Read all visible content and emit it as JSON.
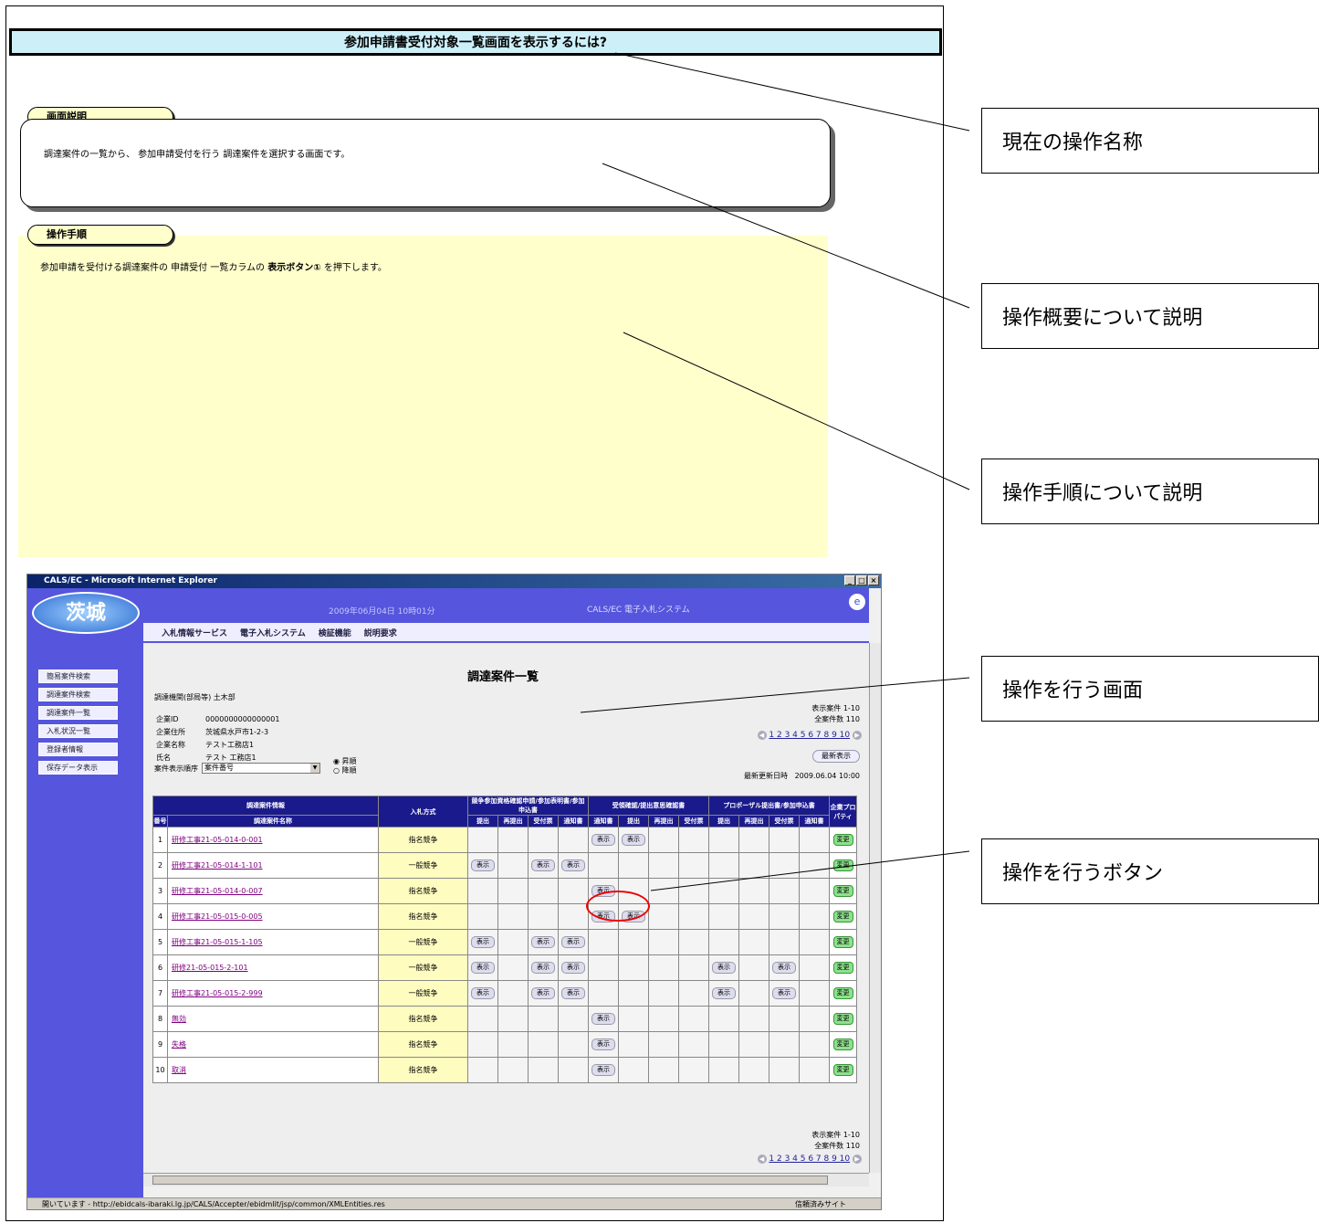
{
  "manual": {
    "title": "参加申請書受付対象一覧画面を表示するには?",
    "section1_label": "画面説明",
    "section1_text": "調達案件の一覧から、 参加申請受付を行う 調達案件を選択する画面です。",
    "section2_label": "操作手順",
    "section2_text_pre": "参加申請を受付ける調達案件の 申請受付 一覧カラムの ",
    "section2_text_bold": "表示ボタン①",
    "section2_text_post": " を押下します。"
  },
  "callouts": [
    "現在の操作名称",
    "操作概要について説明",
    "操作手順について説明",
    "操作を行う画面",
    "操作を行うボタン"
  ],
  "ie": {
    "window_title": "CALS/EC - Microsoft Internet Explorer",
    "logo_text": "茨城",
    "datetime": "2009年06月04日 10時01分",
    "system_name": "CALS/EC 電子入札システム",
    "menu": [
      "入札情報サービス",
      "電子入札システム",
      "検証機能",
      "説明要求"
    ],
    "sidebar": [
      "簡易案件検索",
      "調達案件検索",
      "調達案件一覧",
      "入札状況一覧",
      "登録者情報",
      "保存データ表示"
    ],
    "page_title": "調達案件一覧",
    "org_label": "調達機関(部局等)",
    "org_value": "土木部",
    "company_id_label": "企業ID",
    "company_id": "0000000000000001",
    "address_label": "企業住所",
    "address": "茨城県水戸市1-2-3",
    "company_name_label": "企業名称",
    "company_name": "テスト工務店1",
    "person_label": "氏名",
    "person": "テスト 工務店1",
    "display_range": "表示案件 1-10",
    "total": "全案件数 110",
    "pages": "1 2 3 4 5 6 7 8 9 10",
    "latest_button": "最新表示",
    "sort_label": "案件表示順序",
    "sort_value": "案件番号",
    "radio_asc": "昇順",
    "radio_desc": "降順",
    "updated_label": "最新更新日時",
    "updated_value": "2009.06.04 10:00",
    "table_headers": {
      "case_info": "調達案件情報",
      "method": "入札方式",
      "group1": "競争参加資格確認申請/参加表明書/参加申込書",
      "group2": "受領確認/提出意思確認書",
      "group3": "プロポーザル提出書/参加申込書",
      "prop": "企業プロパティ",
      "no": "番号",
      "case_name": "調達案件名称",
      "sub": [
        "提出",
        "再提出",
        "受付票",
        "通知書",
        "通知書",
        "提出",
        "再提出",
        "受付票",
        "提出",
        "再提出",
        "受付票",
        "通知書"
      ]
    },
    "show_label": "表示",
    "change_label": "変更",
    "rows": [
      {
        "no": "1",
        "name": "研修工事21-05-014-0-001",
        "method": "指名競争"
      },
      {
        "no": "2",
        "name": "研修工事21-05-014-1-101",
        "method": "一般競争"
      },
      {
        "no": "3",
        "name": "研修工事21-05-014-0-007",
        "method": "指名競争"
      },
      {
        "no": "4",
        "name": "研修工事21-05-015-0-005",
        "method": "指名競争"
      },
      {
        "no": "5",
        "name": "研修工事21-05-015-1-105",
        "method": "一般競争"
      },
      {
        "no": "6",
        "name": "研修21-05-015-2-101",
        "method": "一般競争"
      },
      {
        "no": "7",
        "name": "研修工事21-05-015-2-999",
        "method": "一般競争"
      },
      {
        "no": "8",
        "name": "無効",
        "method": "指名競争"
      },
      {
        "no": "9",
        "name": "失格",
        "method": "指名競争"
      },
      {
        "no": "10",
        "name": "取消",
        "method": "指名競争"
      }
    ],
    "status_url": "開いています - http://ebidcals-ibaraki.lg.jp/CALS/Accepter/ebidmlit/jsp/common/XMLEntities.res",
    "status_zone": "信頼済みサイト"
  }
}
